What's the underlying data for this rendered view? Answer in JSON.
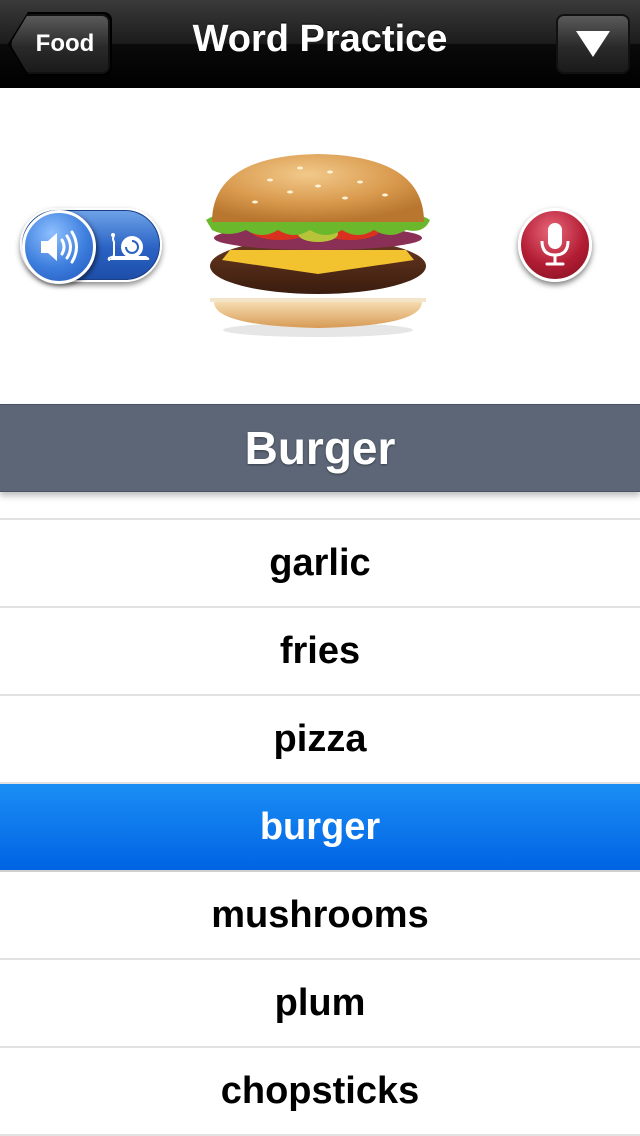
{
  "navbar": {
    "back_label": "Food",
    "title": "Word Practice"
  },
  "hero": {
    "image_icon": "burger-image",
    "speaker_icon": "speaker-icon",
    "snail_icon": "snail-icon",
    "mic_icon": "microphone-icon"
  },
  "current_word": "Burger",
  "word_list": {
    "items": [
      {
        "label": ""
      },
      {
        "label": "garlic"
      },
      {
        "label": "fries"
      },
      {
        "label": "pizza"
      },
      {
        "label": "burger",
        "selected": true
      },
      {
        "label": "mushrooms"
      },
      {
        "label": "plum"
      },
      {
        "label": "chopsticks"
      }
    ]
  },
  "colors": {
    "banner": "#5c6676",
    "selected_row": "#0a78ee",
    "speed_toggle": "#2a62c4",
    "mic_button": "#b31d34"
  }
}
